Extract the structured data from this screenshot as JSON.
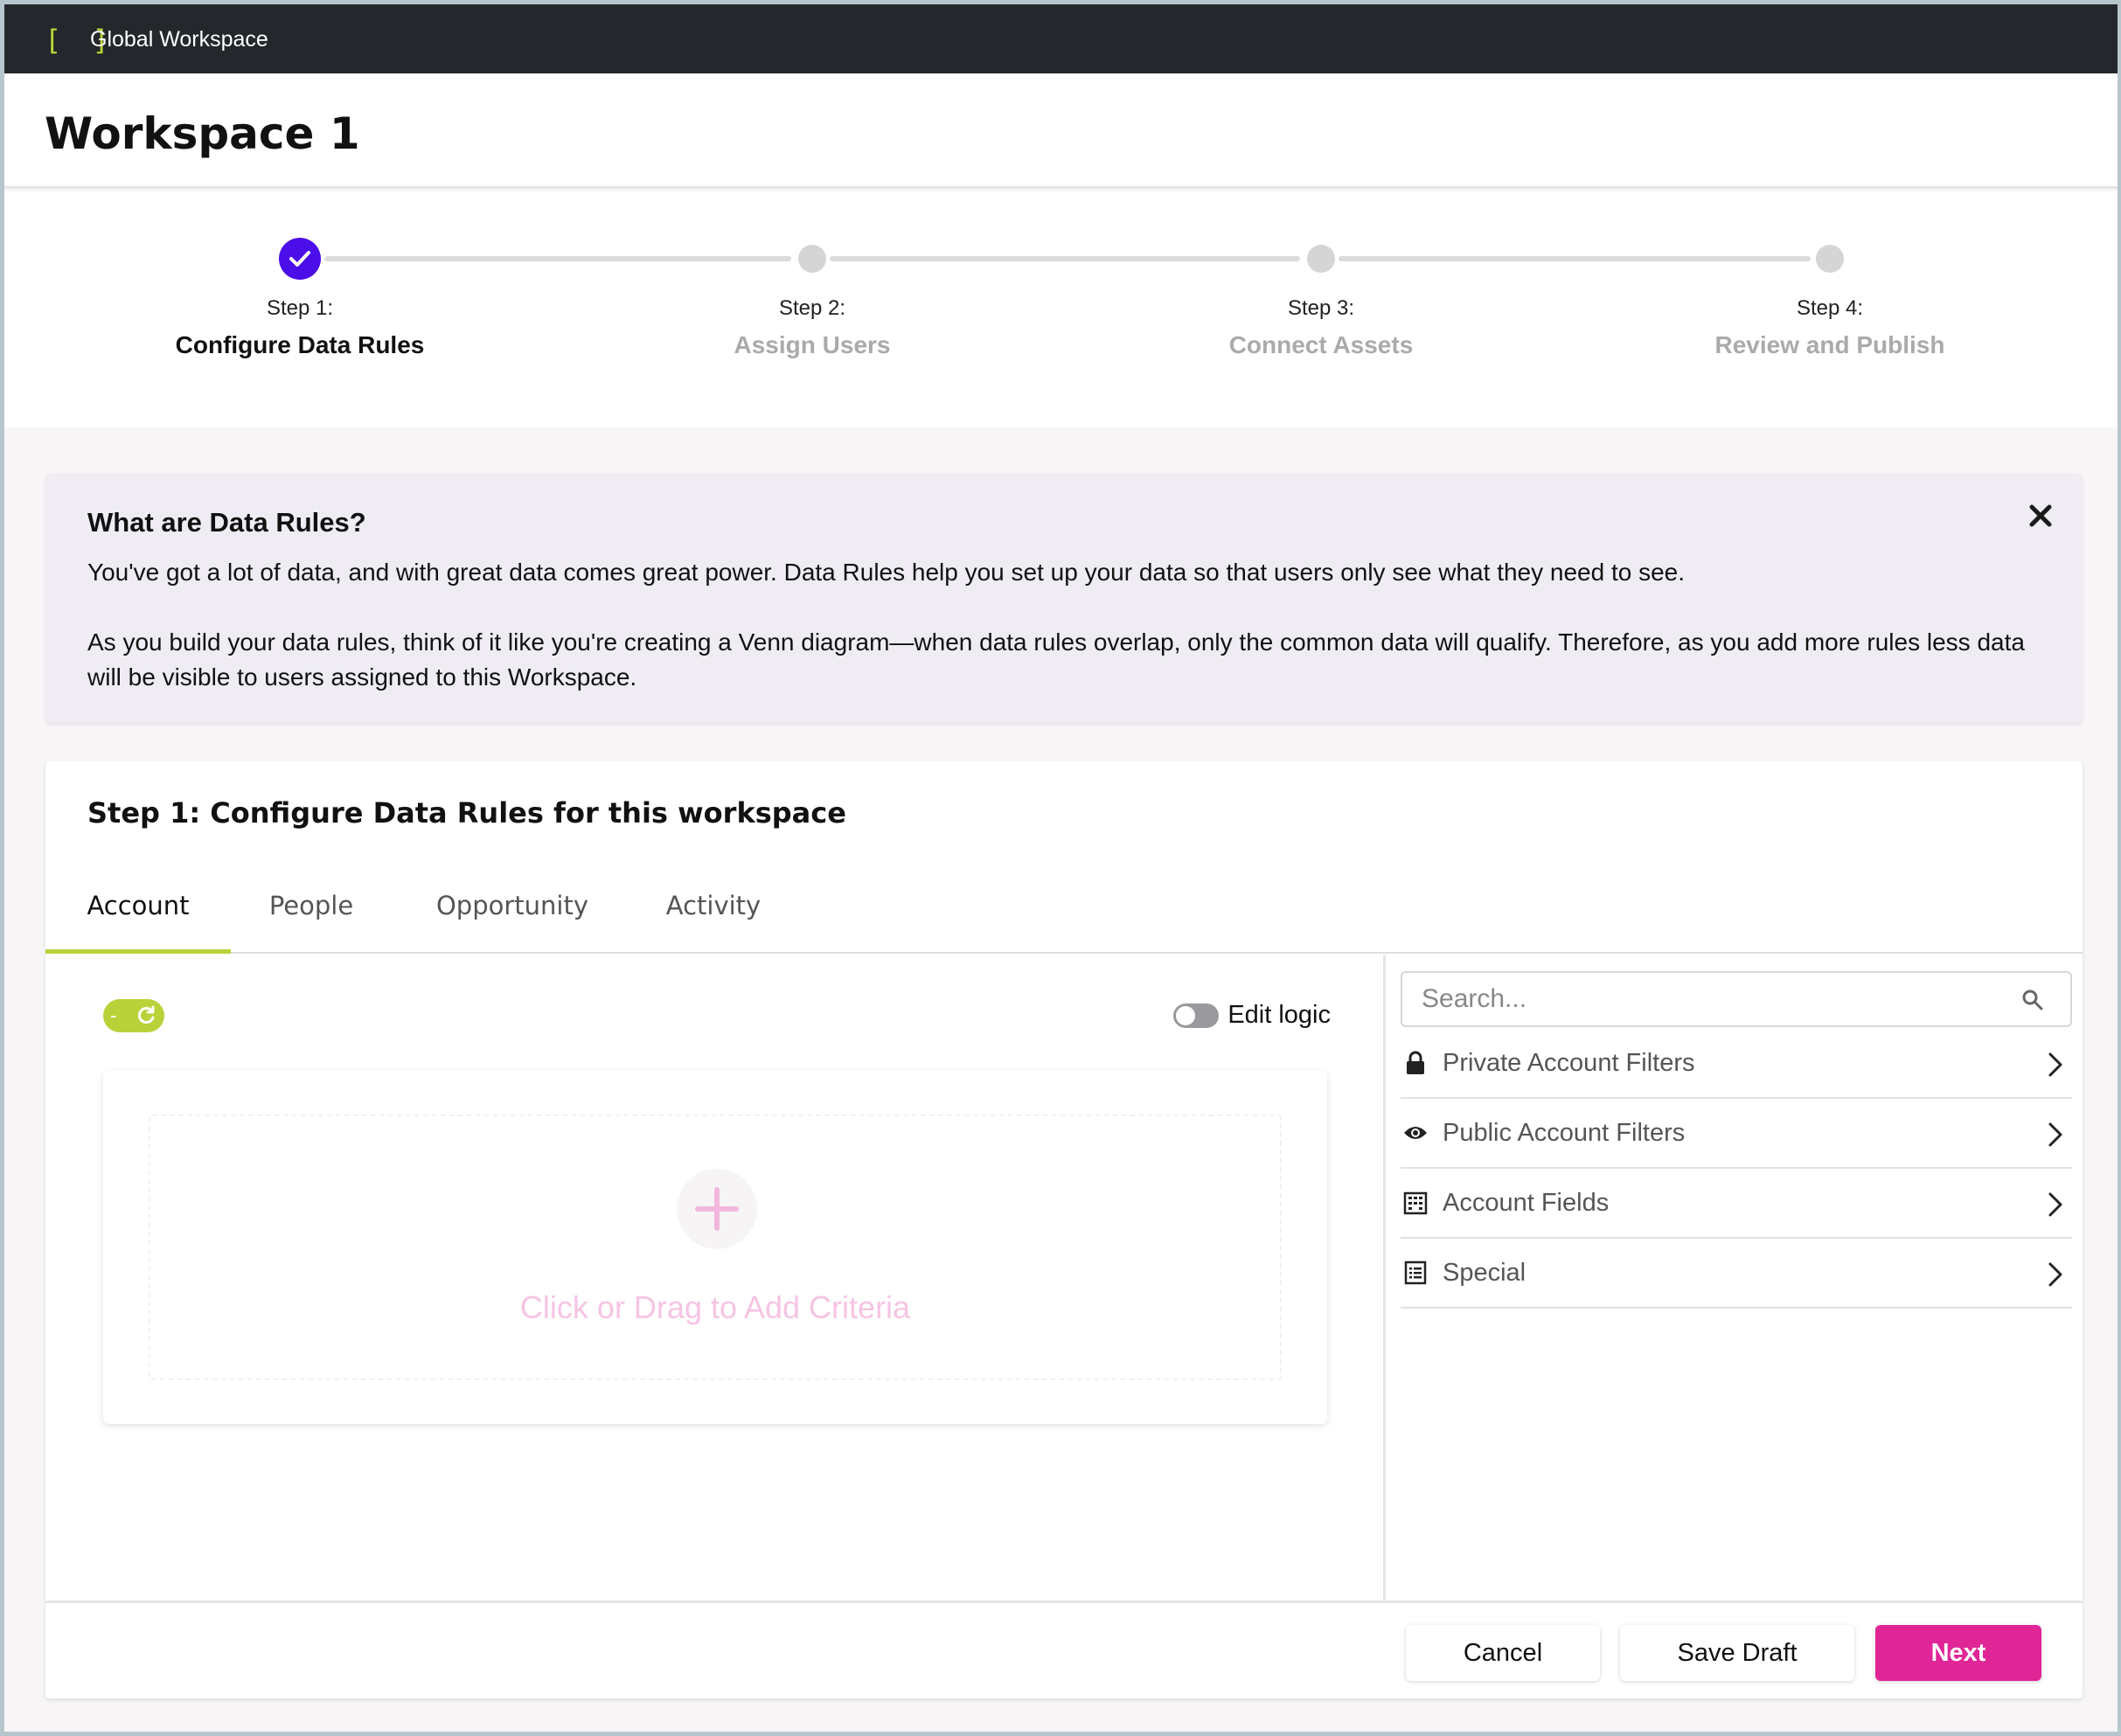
{
  "topbar": {
    "brand_icon": "[ ]",
    "title": "Global Workspace"
  },
  "header": {
    "title": "Workspace 1"
  },
  "stepper": {
    "steps": [
      {
        "number": "Step 1:",
        "name": "Configure Data Rules",
        "status": "complete"
      },
      {
        "number": "Step 2:",
        "name": "Assign Users",
        "status": "pending"
      },
      {
        "number": "Step 3:",
        "name": "Connect Assets",
        "status": "pending"
      },
      {
        "number": "Step 4:",
        "name": "Review and Publish",
        "status": "pending"
      }
    ],
    "colors": {
      "complete": "#4b0ee8",
      "pending": "#d5d5d5"
    }
  },
  "info": {
    "title": "What are Data Rules?",
    "paragraph_1": "You've got a lot of data, and with great data comes great power. Data Rules help you set up your data so that users only see what they need to see.",
    "paragraph_2": "As you build your data rules, think of it like you're creating a Venn diagram—when data rules overlap, only the common data will qualify. Therefore, as you add more rules less data will be visible to users assigned to this Workspace.",
    "close_icon": "close-icon"
  },
  "card": {
    "title": "Step 1: Configure Data Rules for this workspace",
    "tabs": [
      {
        "label": "Account",
        "active": true
      },
      {
        "label": "People",
        "active": false
      },
      {
        "label": "Opportunity",
        "active": false
      },
      {
        "label": "Activity",
        "active": false
      }
    ],
    "builder": {
      "toggle_symbol": "-",
      "edit_logic_label": "Edit logic",
      "edit_logic_on": false,
      "drop_text": "Click or Drag to Add Criteria"
    },
    "sidepanel": {
      "search_placeholder": "Search...",
      "items": [
        {
          "label": "Private Account Filters",
          "icon": "lock-icon"
        },
        {
          "label": "Public Account Filters",
          "icon": "eye-icon"
        },
        {
          "label": "Account Fields",
          "icon": "building-icon"
        },
        {
          "label": "Special",
          "icon": "list-icon"
        }
      ]
    },
    "footer": {
      "cancel_label": "Cancel",
      "save_draft_label": "Save Draft",
      "next_label": "Next"
    }
  },
  "colors": {
    "accent_lime": "#b9d23a",
    "primary_pink": "#e02597",
    "step_purple": "#4b0ee8"
  }
}
